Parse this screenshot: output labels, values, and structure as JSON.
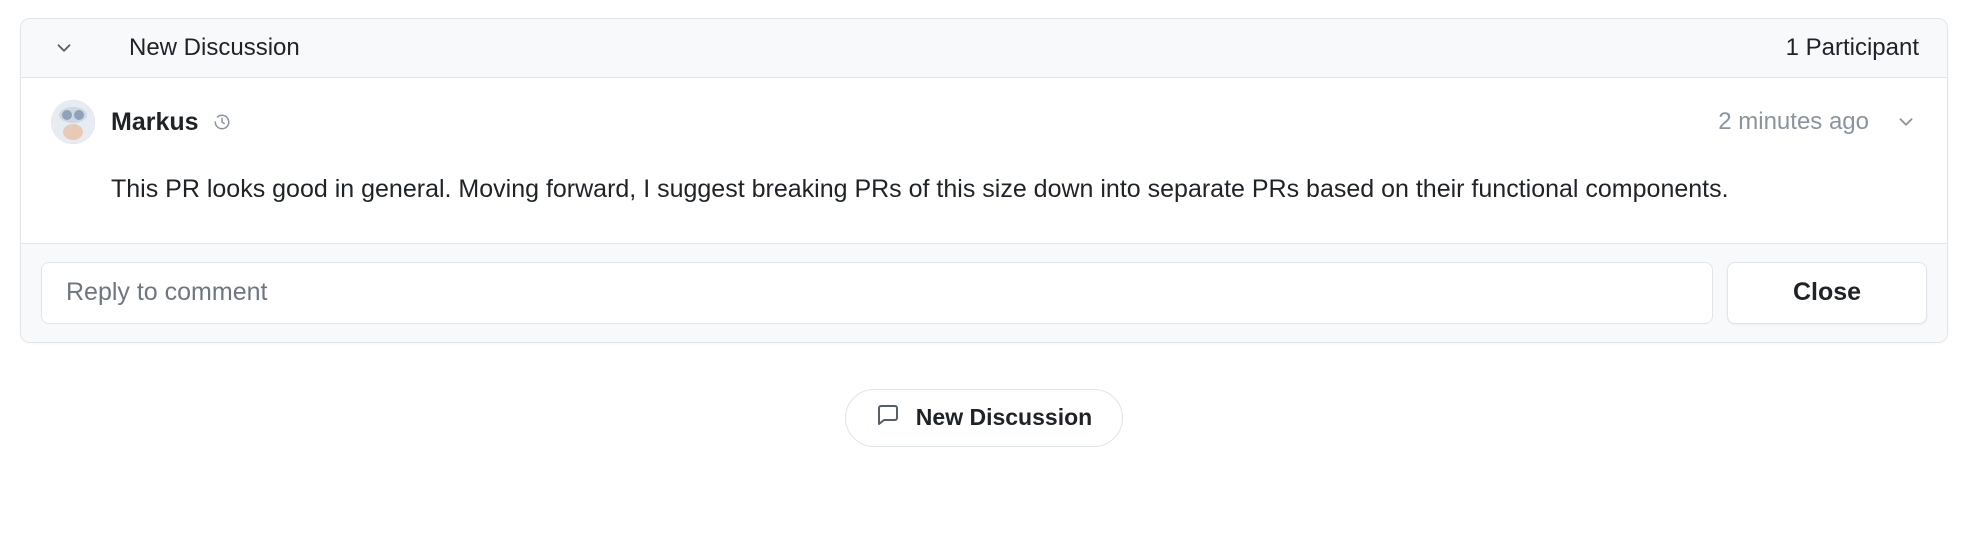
{
  "header": {
    "title": "New Discussion",
    "participants": "1 Participant"
  },
  "comment": {
    "author": "Markus",
    "timestamp": "2 minutes ago",
    "body": "This PR looks good in general. Moving forward, I suggest breaking PRs of this size down into separate PRs based on their functional components."
  },
  "reply": {
    "placeholder": "Reply to comment",
    "close_label": "Close"
  },
  "footer": {
    "new_discussion_label": "New Discussion"
  }
}
